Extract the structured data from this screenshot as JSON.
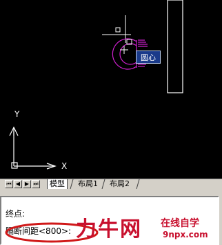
{
  "drawing": {
    "tooltip": "圆心",
    "ucs_x": "X",
    "ucs_y": "Y"
  },
  "layout_tabs": {
    "nav_buttons": [
      "first-icon",
      "prev-icon",
      "next-icon",
      "last-icon"
    ],
    "tabs": [
      {
        "label": "模型",
        "active": true
      },
      {
        "label": "布局1",
        "active": false
      },
      {
        "label": "布局2",
        "active": false
      }
    ]
  },
  "command": {
    "line1": "终点:",
    "line2": "隔断间距<800>:"
  },
  "watermark": {
    "main": "力牛网",
    "side": "在线自学",
    "url": "9npx.com"
  },
  "colors": {
    "canvas_bg": "#000000",
    "magenta": "#d020d0",
    "watermark": "#c8102e",
    "highlight": "#d01818"
  }
}
